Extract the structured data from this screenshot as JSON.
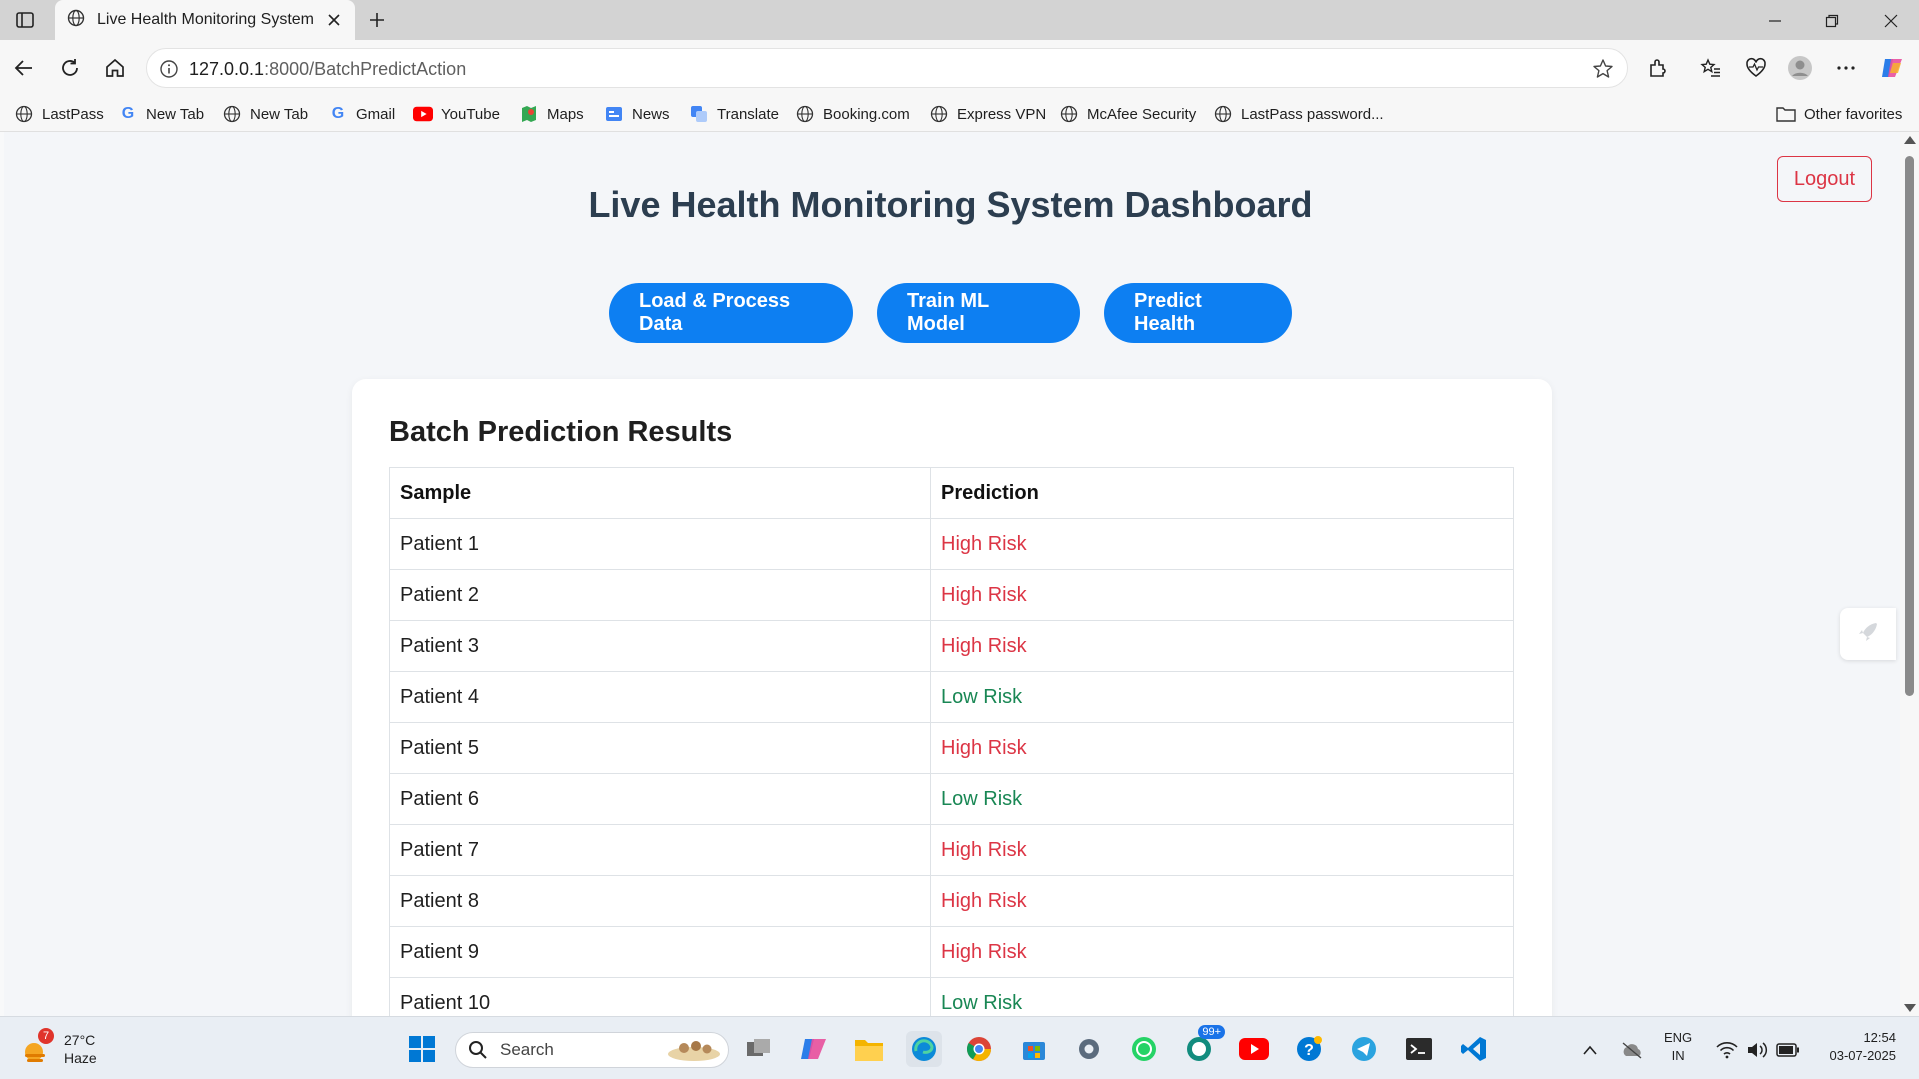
{
  "browser": {
    "tab_title": "Live Health Monitoring System",
    "url_host": "127.0.0.1",
    "url_rest": ":8000/BatchPredictAction",
    "bookmarks": [
      {
        "label": "LastPass",
        "icon": "globe-icon"
      },
      {
        "label": "New Tab",
        "icon": "google-icon"
      },
      {
        "label": "New Tab",
        "icon": "globe-icon"
      },
      {
        "label": "Gmail",
        "icon": "google-icon"
      },
      {
        "label": "YouTube",
        "icon": "youtube-icon"
      },
      {
        "label": "Maps",
        "icon": "maps-icon"
      },
      {
        "label": "News",
        "icon": "news-icon"
      },
      {
        "label": "Translate",
        "icon": "translate-icon"
      },
      {
        "label": "Booking.com",
        "icon": "globe-icon"
      },
      {
        "label": "Express VPN",
        "icon": "globe-icon"
      },
      {
        "label": "McAfee Security",
        "icon": "globe-icon"
      },
      {
        "label": "LastPass password...",
        "icon": "globe-icon"
      }
    ],
    "other_favorites": "Other favorites"
  },
  "page": {
    "logout_label": "Logout",
    "title": "Live Health Monitoring System Dashboard",
    "actions": [
      "Load & Process Data",
      "Train ML Model",
      "Predict Health"
    ],
    "results": {
      "heading": "Batch Prediction Results",
      "columns": [
        "Sample",
        "Prediction"
      ],
      "rows": [
        {
          "sample": "Patient 1",
          "prediction": "High Risk",
          "level": "high"
        },
        {
          "sample": "Patient 2",
          "prediction": "High Risk",
          "level": "high"
        },
        {
          "sample": "Patient 3",
          "prediction": "High Risk",
          "level": "high"
        },
        {
          "sample": "Patient 4",
          "prediction": "Low Risk",
          "level": "low"
        },
        {
          "sample": "Patient 5",
          "prediction": "High Risk",
          "level": "high"
        },
        {
          "sample": "Patient 6",
          "prediction": "Low Risk",
          "level": "low"
        },
        {
          "sample": "Patient 7",
          "prediction": "High Risk",
          "level": "high"
        },
        {
          "sample": "Patient 8",
          "prediction": "High Risk",
          "level": "high"
        },
        {
          "sample": "Patient 9",
          "prediction": "High Risk",
          "level": "high"
        },
        {
          "sample": "Patient 10",
          "prediction": "Low Risk",
          "level": "low"
        }
      ]
    },
    "colors": {
      "primary": "#0d7ff2",
      "high_risk": "#dc3545",
      "low_risk": "#198754",
      "title": "#2c3e50"
    }
  },
  "taskbar": {
    "weather_temp": "27°C",
    "weather_desc": "Haze",
    "weather_badge": "7",
    "search_placeholder": "Search",
    "whatsapp_badge": "99+",
    "lang_line1": "ENG",
    "lang_line2": "IN",
    "time": "12:54",
    "date": "03-07-2025"
  }
}
